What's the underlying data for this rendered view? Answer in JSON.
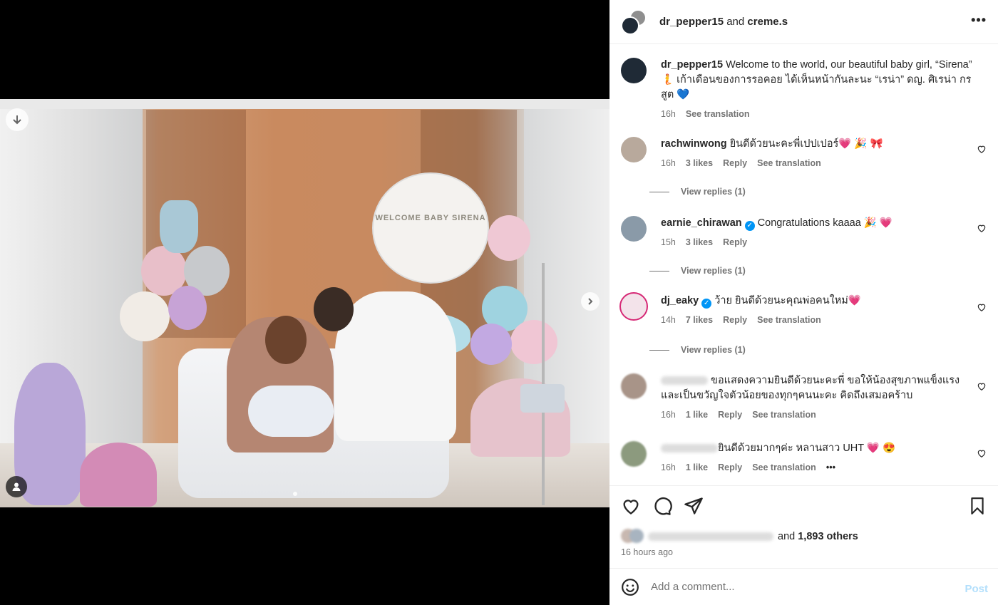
{
  "post": {
    "author": "dr_pepper15",
    "collab_joiner": "and",
    "collaborator": "creme.s",
    "caption_user": "dr_pepper15",
    "caption": "Welcome to the world, our beautiful baby girl, “Sirena” 🧜 เก้าเดือนของการรอคอย ได้เห็นหน้ากันละนะ “เรน่า” ดญ. ศิเรน่า กรสูต 💙",
    "caption_time": "16h",
    "see_translation": "See translation",
    "balloon_text": "WELCOME BABY SIRENA"
  },
  "comments": [
    {
      "user": "rachwinwong",
      "verified": false,
      "text": "ยินดีด้วยนะคะพี่เปปเปอร์💗 🎉 🎀",
      "time": "16h",
      "likes": "3 likes",
      "reply": "Reply",
      "translate": "See translation",
      "view_replies": "View replies (1)"
    },
    {
      "user": "earnie_chirawan",
      "verified": true,
      "text": "Congratulations kaaaa 🎉 💗",
      "time": "15h",
      "likes": "3 likes",
      "reply": "Reply",
      "view_replies": "View replies (1)"
    },
    {
      "user": "dj_eaky",
      "verified": true,
      "text": "ว้าย ยินดีด้วยนะคุณพ่อคนใหม่💗",
      "time": "14h",
      "likes": "7 likes",
      "reply": "Reply",
      "translate": "See translation",
      "view_replies": "View replies (1)"
    },
    {
      "text": "ขอแสดงความยินดีด้วยนะคะพี่ ขอให้น้องสุขภาพแข็งแรง และเป็นขวัญใจตัวน้อยของทุกๆคนนะคะ คิดถึงเสมอคร้าบ",
      "time": "16h",
      "likes": "1 like",
      "reply": "Reply",
      "translate": "See translation"
    },
    {
      "text": "ยินดีด้วยมากๆค่ะ หลานสาว UHT 💗 😍",
      "time": "16h",
      "likes": "1 like",
      "reply": "Reply",
      "translate": "See translation",
      "more": "•••"
    }
  ],
  "actions": {
    "likes_joiner": "and",
    "likes_count": "1,893 others",
    "timestamp": "16 hours ago"
  },
  "composer": {
    "placeholder": "Add a comment...",
    "post_label": "Post"
  },
  "colors": {
    "link_blue": "#0095f6",
    "post_disabled": "#b2dffc",
    "muted_text": "#737373"
  },
  "icons": [
    "download-icon",
    "chevron-right-icon",
    "user-tag-icon",
    "more-icon",
    "heart-icon",
    "comment-icon",
    "share-icon",
    "bookmark-icon",
    "emoji-icon",
    "verified-icon"
  ]
}
